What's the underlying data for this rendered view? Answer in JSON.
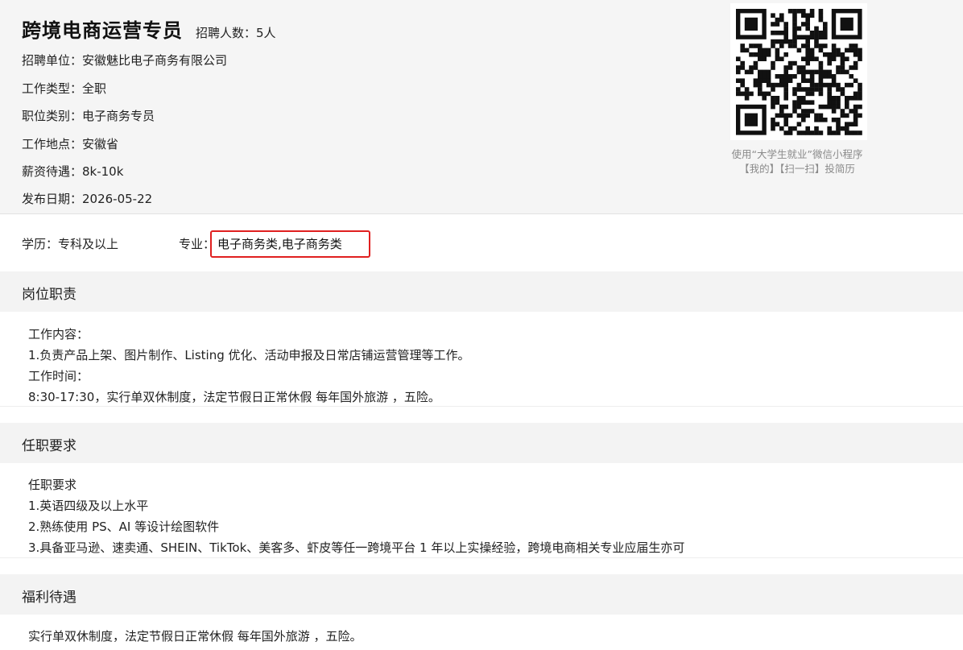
{
  "job": {
    "title": "跨境电商运营专员",
    "headcount": "招聘人数：5人",
    "company": "招聘单位：安徽魅比电子商务有限公司",
    "work_type": "工作类型：全职",
    "category": "职位类别：电子商务专员",
    "location": "工作地点：安徽省",
    "salary": "薪资待遇：8k-10k",
    "publish_date": "发布日期：2026-05-22"
  },
  "qr": {
    "caption_line1": "使用“大学生就业”微信小程序",
    "caption_line2": "【我的】【扫一扫】投简历"
  },
  "requirements_row": {
    "education": "学历：专科及以上",
    "major_label": "专业：",
    "major_value": "电子商务类,电子商务类"
  },
  "sections": {
    "duties": {
      "heading": "岗位职责",
      "lines": [
        "工作内容：",
        "1.负责产品上架、图片制作、Listing 优化、活动申报及日常店铺运营管理等工作。",
        "工作时间：",
        "8:30-17:30，实行单双休制度，法定节假日正常休假  每年国外旅游 ，五险。"
      ]
    },
    "qualifications": {
      "heading": "任职要求",
      "lines": [
        "任职要求",
        "1.英语四级及以上水平",
        "2.熟练使用 PS、AI 等设计绘图软件",
        "3.具备亚马逊、速卖通、SHEIN、TikTok、美客多、虾皮等任一跨境平台 1 年以上实操经验，跨境电商相关专业应届生亦可"
      ]
    },
    "benefits": {
      "heading": "福利待遇",
      "lines": [
        "实行单双休制度，法定节假日正常休假  每年国外旅游 ，五险。"
      ]
    }
  },
  "colors": {
    "highlight_border": "#e02020",
    "header_bg": "#f5f5f5",
    "section_bg": "#f3f3f3"
  }
}
